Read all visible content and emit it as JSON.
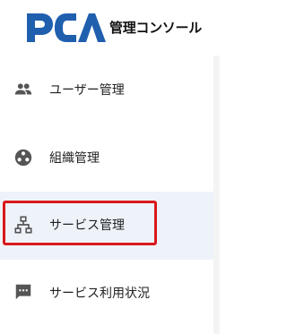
{
  "header": {
    "logo_text": "PCA",
    "console_title": "管理コンソール"
  },
  "nav": {
    "items": [
      {
        "label": "ユーザー管理",
        "icon": "people-icon",
        "selected": false
      },
      {
        "label": "組織管理",
        "icon": "organization-icon",
        "selected": false
      },
      {
        "label": "サービス管理",
        "icon": "hierarchy-icon",
        "selected": true
      },
      {
        "label": "サービス利用状況",
        "icon": "chat-icon",
        "selected": false
      }
    ]
  },
  "colors": {
    "brand": "#1f5fae",
    "highlight_border": "#d9181b",
    "selected_bg": "#eef3fa",
    "icon": "#555555"
  }
}
